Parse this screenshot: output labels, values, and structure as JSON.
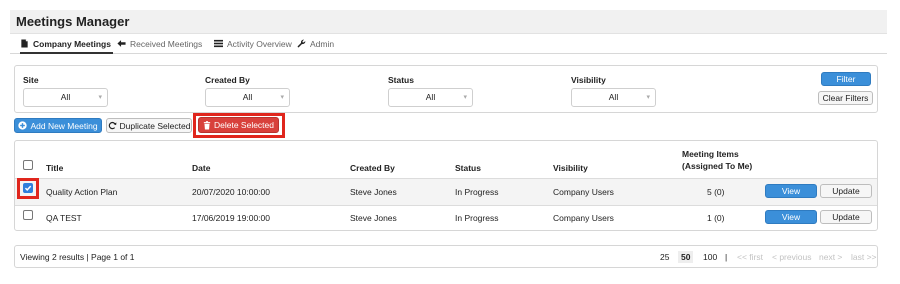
{
  "app": {
    "title": "Meetings Manager"
  },
  "tabs": [
    {
      "label": "Company Meetings",
      "icon": "document-icon"
    },
    {
      "label": "Received Meetings",
      "icon": "arrow-left-icon"
    },
    {
      "label": "Activity Overview",
      "icon": "list-icon"
    },
    {
      "label": "Admin",
      "icon": "wrench-icon"
    }
  ],
  "filters": {
    "site": {
      "label": "Site",
      "value": "All"
    },
    "created_by": {
      "label": "Created By",
      "value": "All"
    },
    "status": {
      "label": "Status",
      "value": "All"
    },
    "visibility": {
      "label": "Visibility",
      "value": "All"
    },
    "filter_button": "Filter",
    "clear_button": "Clear Filters"
  },
  "actions": {
    "add": "Add New Meeting",
    "duplicate": "Duplicate Selected",
    "delete": "Delete Selected"
  },
  "table": {
    "headers": {
      "title": "Title",
      "date": "Date",
      "created_by": "Created By",
      "status": "Status",
      "visibility": "Visibility",
      "items_line1": "Meeting Items",
      "items_line2": "(Assigned To Me)"
    },
    "rows": [
      {
        "checked": true,
        "title": "Quality Action Plan",
        "date": "20/07/2020 10:00:00",
        "created_by": "Steve Jones",
        "status": "In Progress",
        "visibility": "Company Users",
        "items": "5 (0)",
        "view": "View",
        "update": "Update"
      },
      {
        "checked": false,
        "title": "QA TEST",
        "date": "17/06/2019 19:00:00",
        "created_by": "Steve Jones",
        "status": "In Progress",
        "visibility": "Company Users",
        "items": "1 (0)",
        "view": "View",
        "update": "Update"
      }
    ]
  },
  "footer": {
    "summary": "Viewing 2 results | Page 1 of 1",
    "page_sizes": [
      "25",
      "50",
      "100"
    ],
    "separator": "|",
    "first": "<< first",
    "previous": "< previous",
    "next": "next >",
    "last": "last >>"
  },
  "colors": {
    "primary": "#3b8fd9",
    "danger": "#d8403b",
    "highlight": "#e0261d"
  }
}
